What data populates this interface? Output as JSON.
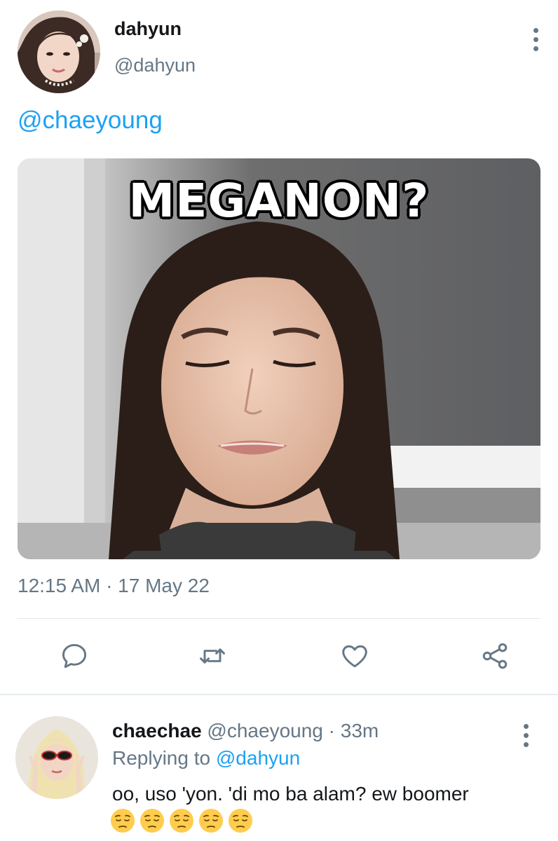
{
  "tweet": {
    "author_name": "dahyun",
    "author_handle": "@dahyun",
    "text": "@chaeyoung",
    "media_caption": "MEGANON?",
    "timestamp": "12:15 AM · 17 May 22"
  },
  "actions": [
    "reply",
    "retweet",
    "like",
    "share"
  ],
  "reply": {
    "author_name": "chaechae",
    "author_handle": "@chaeyoung",
    "separator": " · ",
    "time": "33m",
    "replying_label": "Replying to ",
    "replying_handle": "@dahyun",
    "text": "oo, uso 'yon. 'di mo ba alam? ew boomer",
    "emoji_count": 5,
    "emoji": "pensive-face"
  },
  "colors": {
    "link": "#1da1f2",
    "secondary_text": "#657786",
    "divider": "#e1e8ed"
  }
}
